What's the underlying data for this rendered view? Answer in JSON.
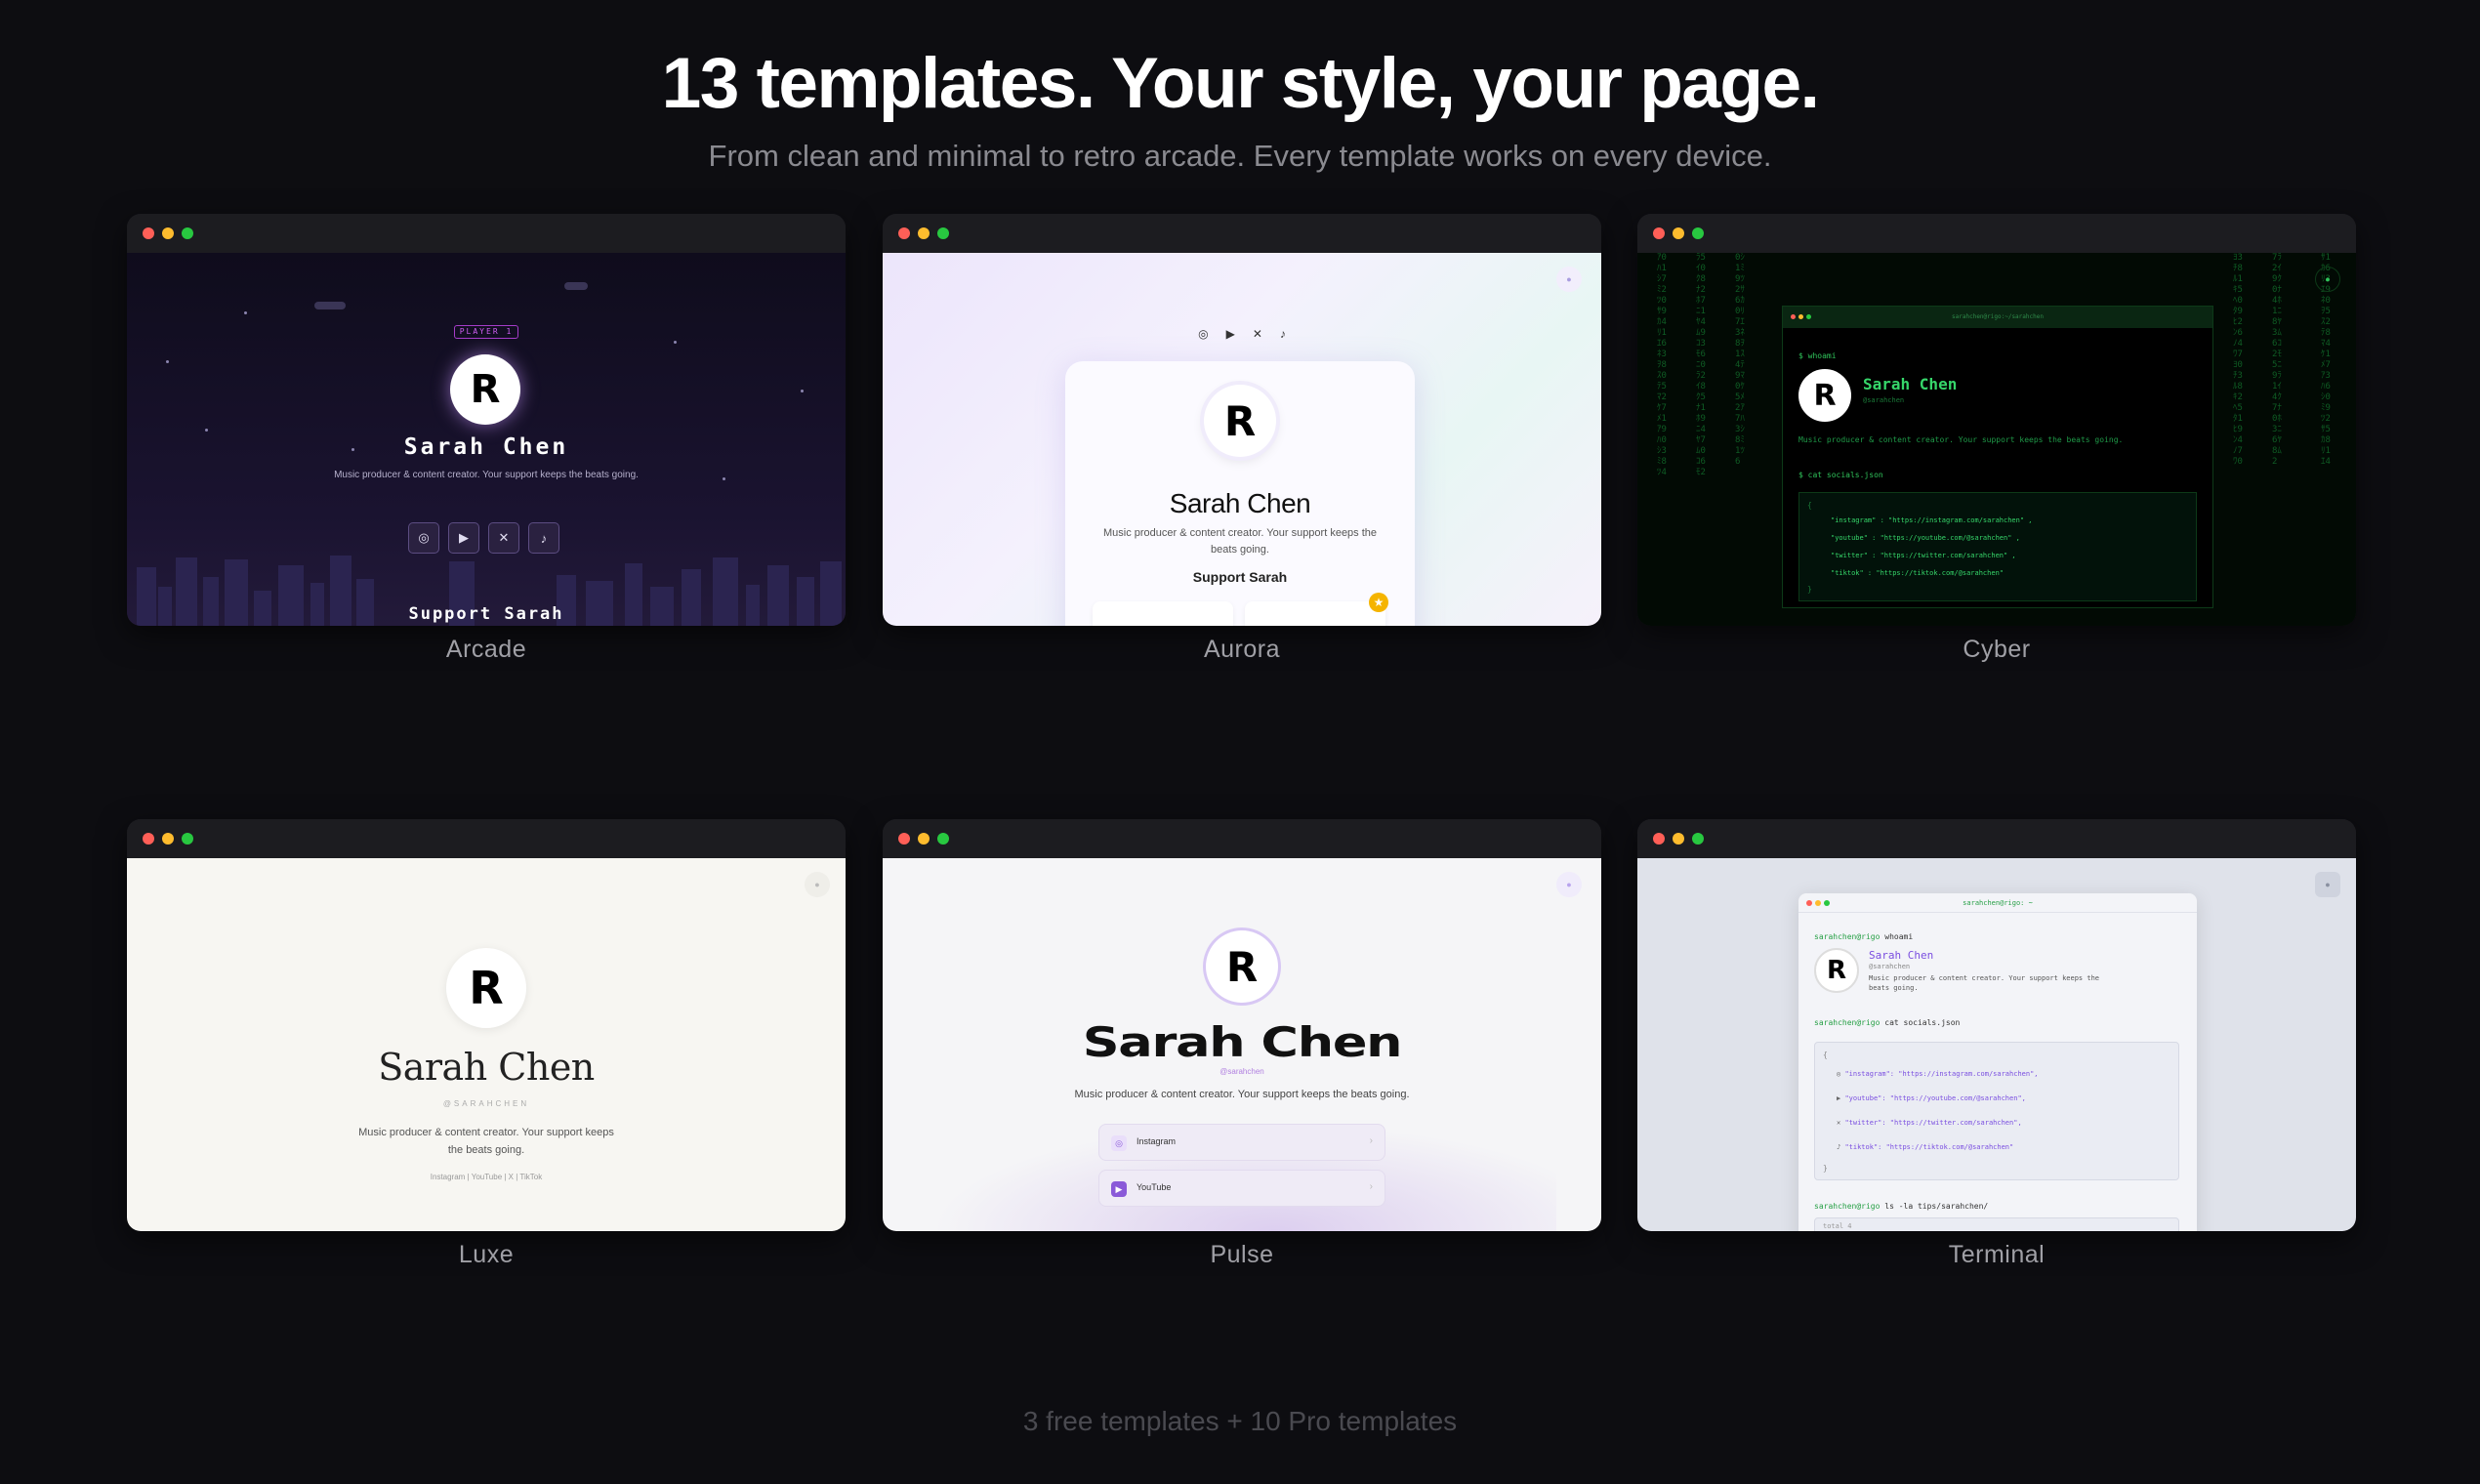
{
  "header": {
    "title": "13 templates. Your style, your page.",
    "subtitle": "From clean and minimal to retro arcade. Every template works on every device."
  },
  "footer": {
    "note": "3 free templates + 10 Pro templates"
  },
  "profile": {
    "initial": "R",
    "name": "Sarah Chen",
    "handle": "@sarahchen",
    "bio": "Music producer & content creator. Your support keeps the beats going."
  },
  "templates": [
    {
      "label": "Arcade",
      "badge": "PLAYER 1",
      "name": "Sarah Chen",
      "bio": "Music producer & content creator. Your support keeps the beats going.",
      "socials": [
        "instagram-icon",
        "youtube-icon",
        "x-icon",
        "tiktok-icon"
      ],
      "support": "Support Sarah"
    },
    {
      "label": "Aurora",
      "name": "Sarah Chen",
      "bio": "Music producer & content creator. Your support keeps the beats going.",
      "support": "Support Sarah",
      "socials": [
        "instagram-icon",
        "youtube-icon",
        "x-icon",
        "tiktok-icon"
      ]
    },
    {
      "label": "Cyber",
      "window_title": "sarahchen@rigo:~/sarahchen",
      "cmd1": "$ whoami",
      "name": "Sarah Chen",
      "handle": "@sarahchen",
      "bio": "Music producer & content creator. Your support keeps the beats going.",
      "cmd2": "$ cat socials.json",
      "json": [
        "\"instagram\" : \"https://instagram.com/sarahchen\" ,",
        "\"youtube\" : \"https://youtube.com/@sarahchen\" ,",
        "\"twitter\" : \"https://twitter.com/sarahchen\" ,",
        "\"tiktok\" : \"https://tiktok.com/@sarahchen\""
      ]
    },
    {
      "label": "Luxe",
      "name": "Sarah Chen",
      "handle": "@SARAHCHEN",
      "bio": "Music producer & content creator. Your support keeps the beats going.",
      "links": "Instagram  |  YouTube  |  X  |  TikTok"
    },
    {
      "label": "Pulse",
      "name": "Sarah Chen",
      "handle": "@sarahchen",
      "bio": "Music producer & content creator. Your support keeps the beats going.",
      "rows": [
        "Instagram",
        "YouTube"
      ]
    },
    {
      "label": "Terminal",
      "window_title": "sarahchen@rigo: ~",
      "prompt": "sarahchen@rigo",
      "cmd1": "whoami",
      "name": "Sarah Chen",
      "handle": "@sarahchen",
      "bio_line1": "Music producer & content creator. Your support keeps the",
      "bio_line2": "beats going.",
      "cmd2": "cat socials.json",
      "json": [
        "\"instagram\": \"https://instagram.com/sarahchen\",",
        "\"youtube\": \"https://youtube.com/@sarahchen\",",
        "\"twitter\": \"https://twitter.com/sarahchen\",",
        "\"tiktok\": \"https://tiktok.com/@sarahchen\""
      ],
      "cmd3": "ls -la tips/sarahchen/",
      "total": "total 4"
    }
  ]
}
